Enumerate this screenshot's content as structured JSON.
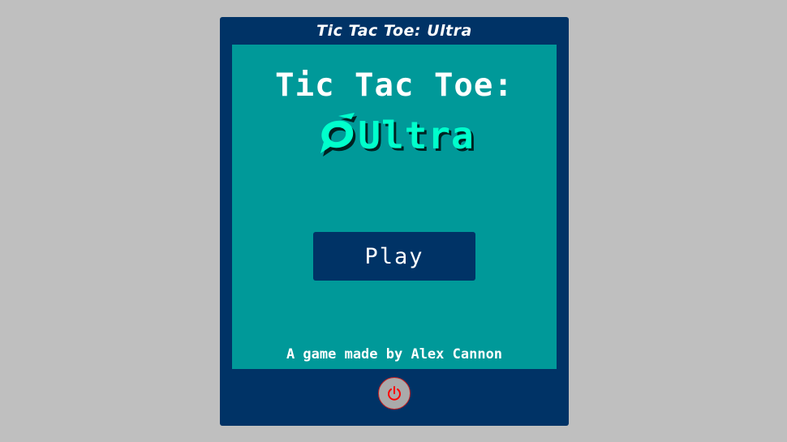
{
  "window": {
    "title": "Tic Tac Toe: Ultra"
  },
  "screen": {
    "title_line1": "Tic Tac Toe:",
    "title_line2": "Ultra",
    "logo_icon": "speech-swirl-icon",
    "play_label": "Play",
    "credit": "A game made by Alex Cannon"
  },
  "controls": {
    "power_icon": "power-icon"
  },
  "colors": {
    "background": "#bfbfbf",
    "frame": "#003366",
    "screen": "#009999",
    "accent": "#00ffcc",
    "power_symbol": "#ff0000"
  }
}
